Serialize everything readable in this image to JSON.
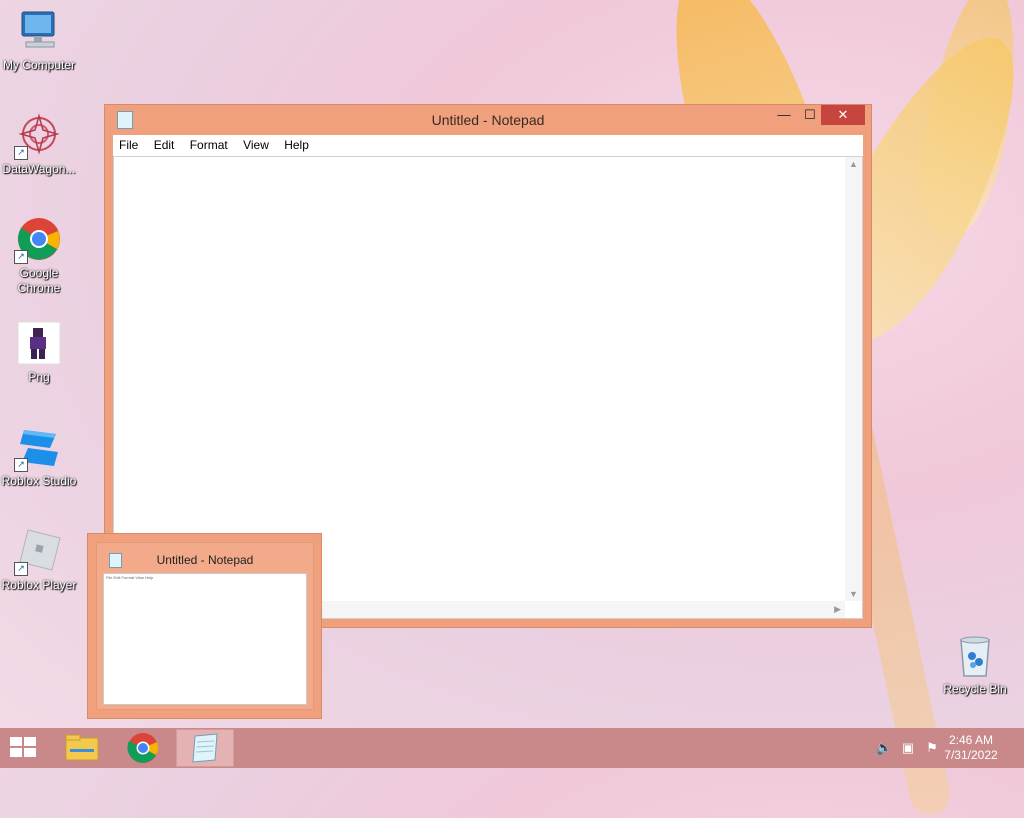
{
  "desktop": {
    "icons": [
      {
        "label": "My Computer"
      },
      {
        "label": "DataWagon..."
      },
      {
        "label": "Google Chrome"
      },
      {
        "label": "Png"
      },
      {
        "label": "Roblox Studio"
      },
      {
        "label": "Roblox Player"
      },
      {
        "label": "Recycle Bin"
      }
    ]
  },
  "window": {
    "title": "Untitled - Notepad",
    "controls": {
      "minimize": "—",
      "maximize": "☐",
      "close": "✕"
    },
    "menu": [
      {
        "label": "File"
      },
      {
        "label": "Edit"
      },
      {
        "label": "Format"
      },
      {
        "label": "View"
      },
      {
        "label": "Help"
      }
    ],
    "content": ""
  },
  "preview": {
    "title": "Untitled - Notepad",
    "mini_menu": "File  Edit  Format  View  Help"
  },
  "taskbar": {
    "clock_time": "2:46 AM",
    "clock_date": "7/31/2022"
  },
  "colors": {
    "window_frame": "#f0a07c",
    "taskbar": "#c9898a",
    "close_button": "#c7453f"
  }
}
